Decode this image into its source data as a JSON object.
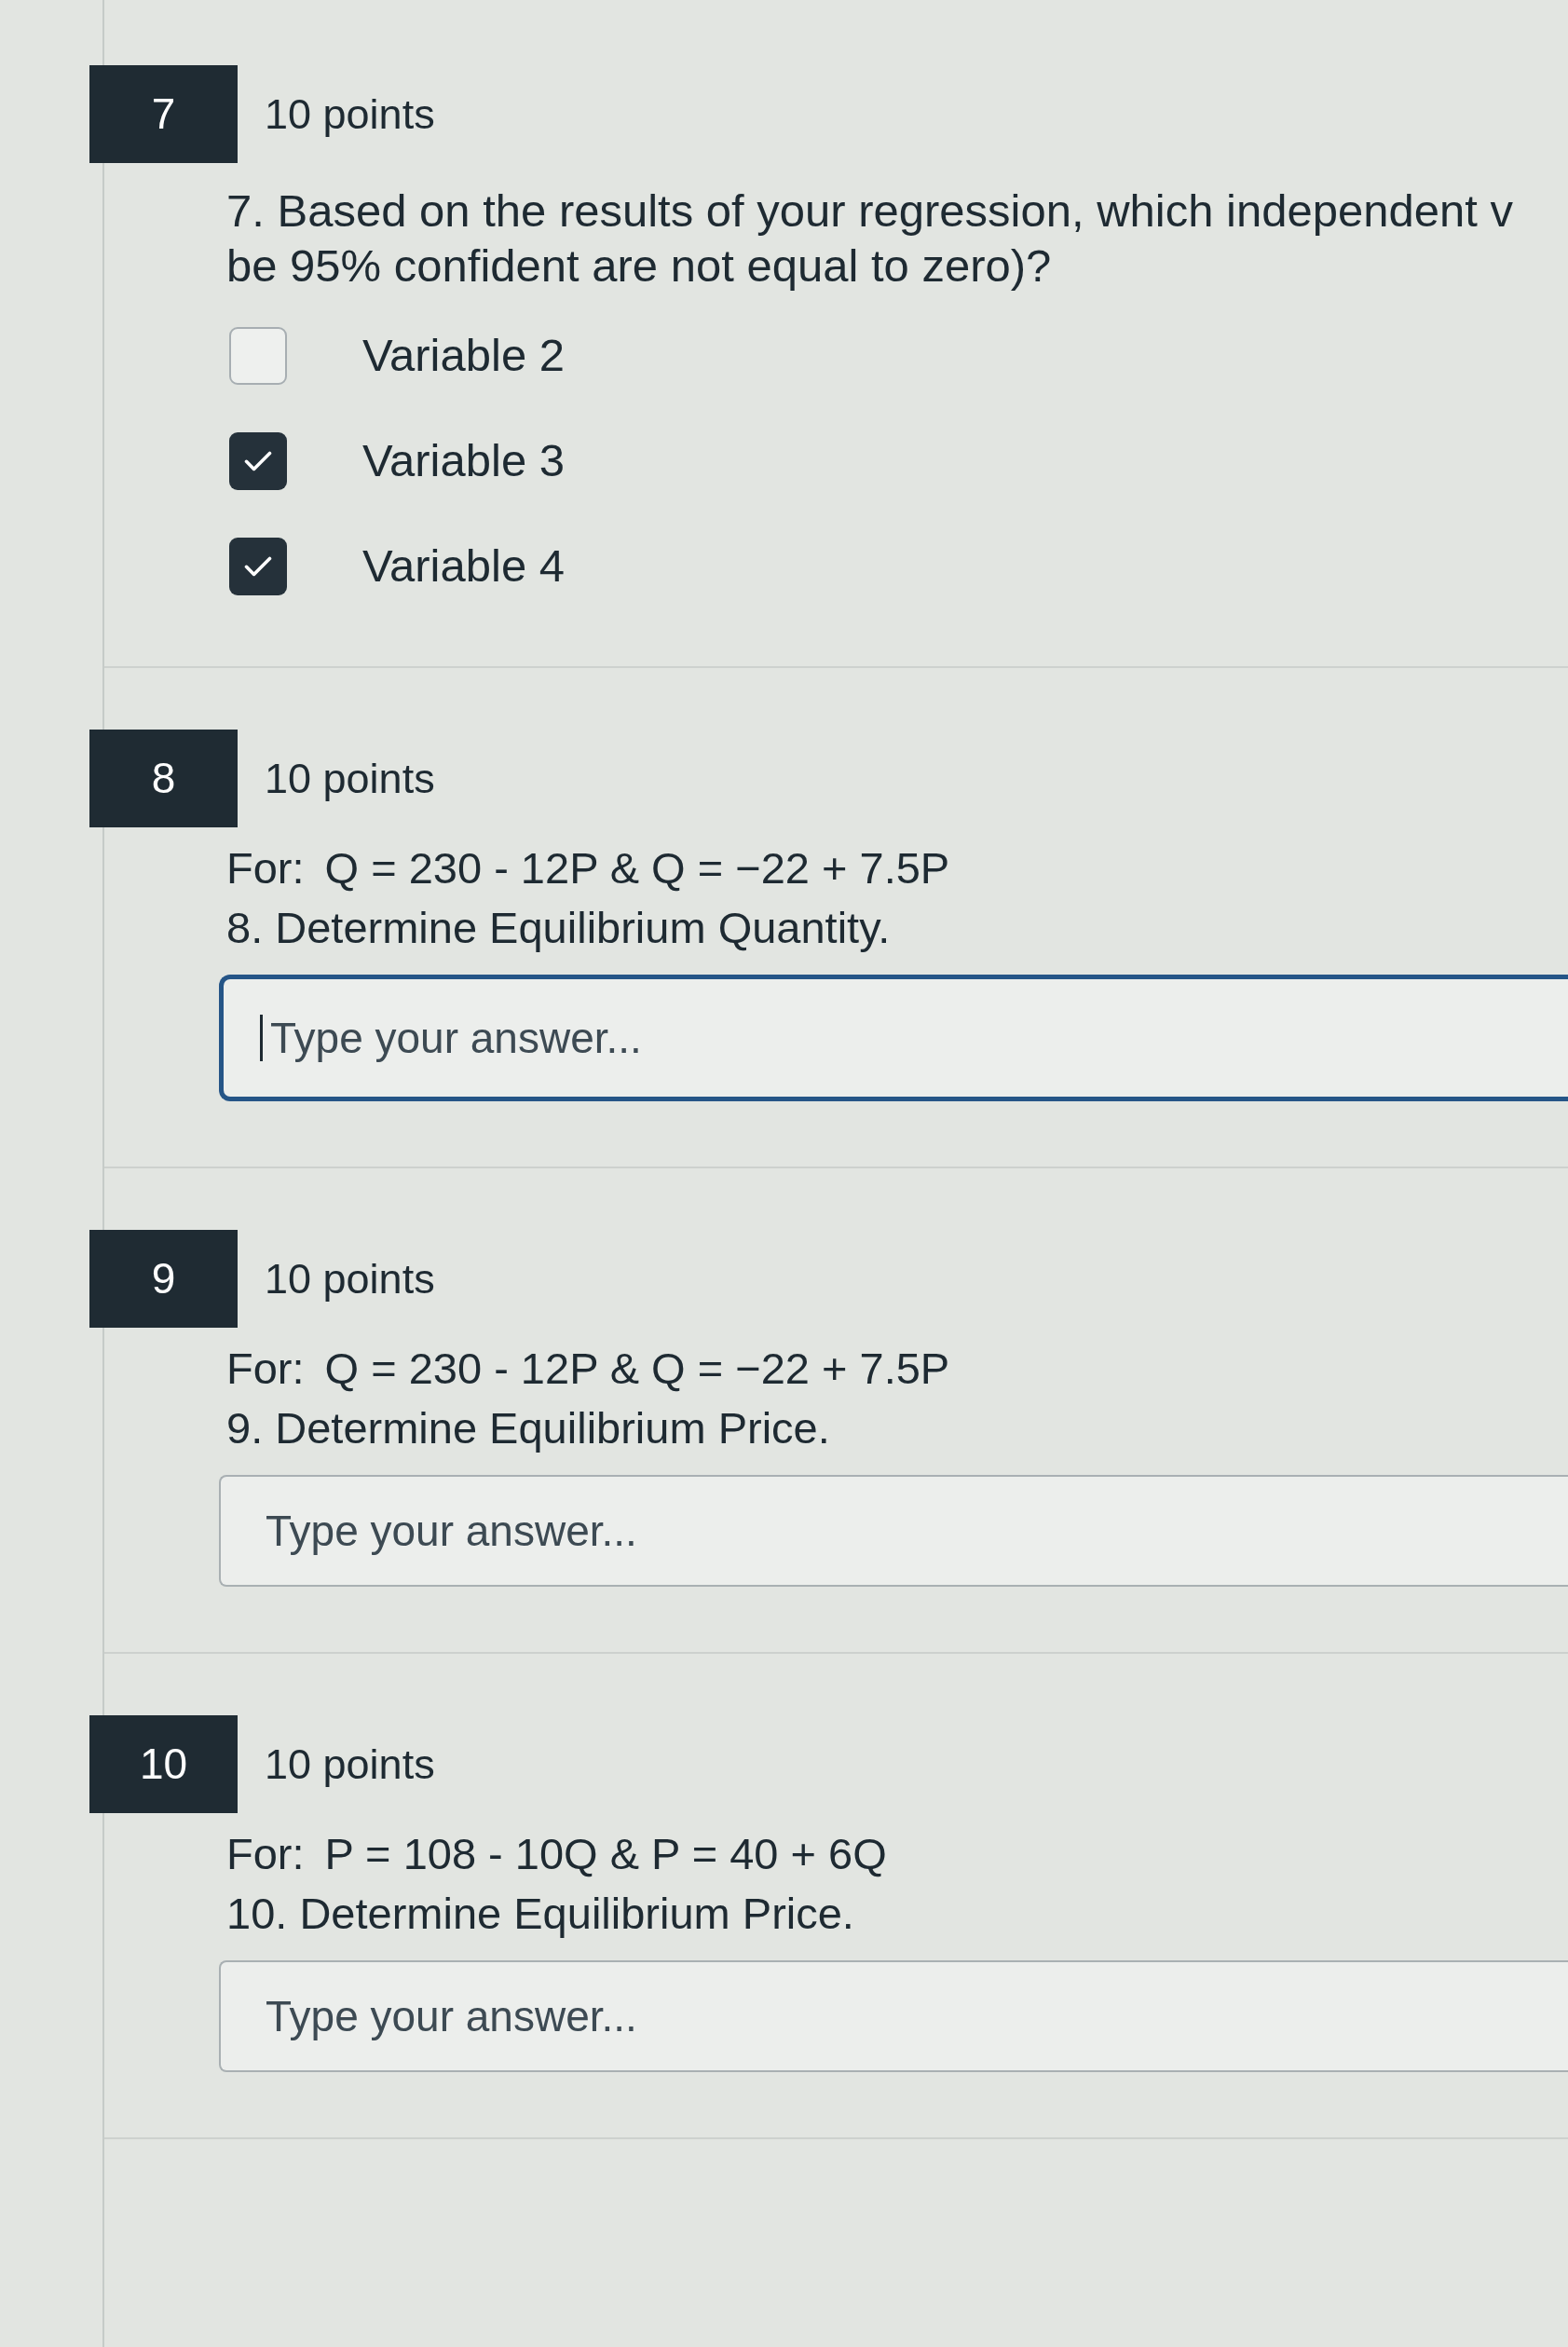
{
  "questions": [
    {
      "number": "7",
      "points": "10 points",
      "kind": "multiple_answer",
      "prompt_lines": [
        "7. Based on the results of your regression, which independent v",
        "be 95% confident are not equal to zero)?"
      ],
      "options": [
        {
          "label": "Variable 2",
          "checked": false
        },
        {
          "label": "Variable 3",
          "checked": true
        },
        {
          "label": "Variable 4",
          "checked": true
        }
      ]
    },
    {
      "number": "8",
      "points": "10 points",
      "kind": "short_answer",
      "given_label": "For:",
      "given_equation": "Q = 230 - 12P & Q = −22 + 7.5P",
      "prompt": "8. Determine Equilibrium Quantity.",
      "answer": {
        "placeholder": "Type your answer...",
        "focused": true
      }
    },
    {
      "number": "9",
      "points": "10 points",
      "kind": "short_answer",
      "given_label": "For:",
      "given_equation": "Q = 230 - 12P & Q = −22 + 7.5P",
      "prompt": "9. Determine Equilibrium Price.",
      "answer": {
        "placeholder": "Type your answer...",
        "focused": false
      }
    },
    {
      "number": "10",
      "points": "10 points",
      "kind": "short_answer",
      "given_label": "For:",
      "given_equation": "P = 108 - 10Q & P = 40 + 6Q",
      "prompt": "10. Determine Equilibrium Price.",
      "answer": {
        "placeholder": "Type your answer...",
        "focused": false
      }
    }
  ]
}
